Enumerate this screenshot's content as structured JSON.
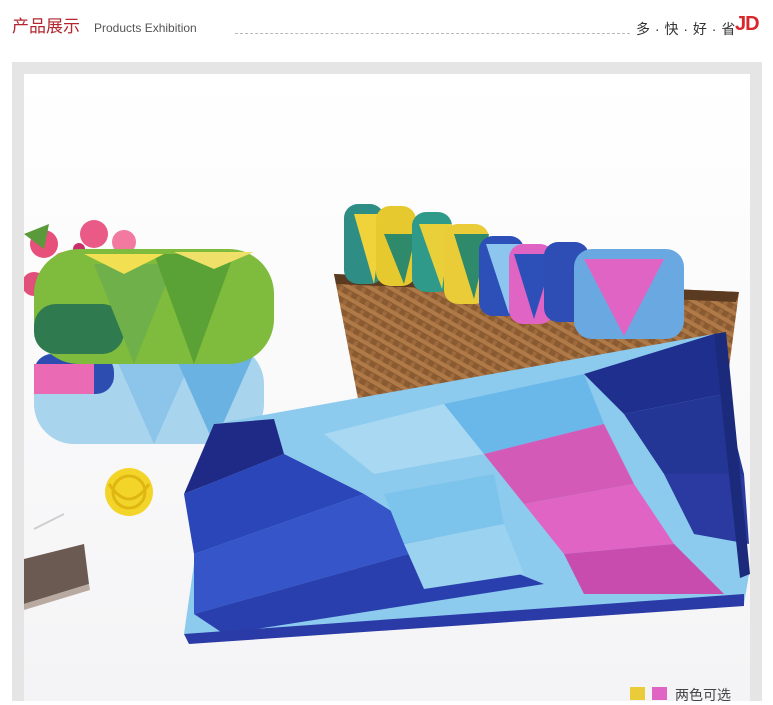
{
  "header": {
    "title_cn": "产品展示",
    "title_en": "Products Exhibition",
    "slogan": "多 · 快 · 好 · 省",
    "brand": "JD"
  },
  "photo": {
    "subject": "towel-product-photo"
  },
  "legend": {
    "text": "两色可选",
    "swatches": [
      "#e9cc38",
      "#e064c4"
    ]
  },
  "colors": {
    "title_red": "#b3262d",
    "jd_red": "#d8262c",
    "frame_gray": "#e5e5e5"
  }
}
